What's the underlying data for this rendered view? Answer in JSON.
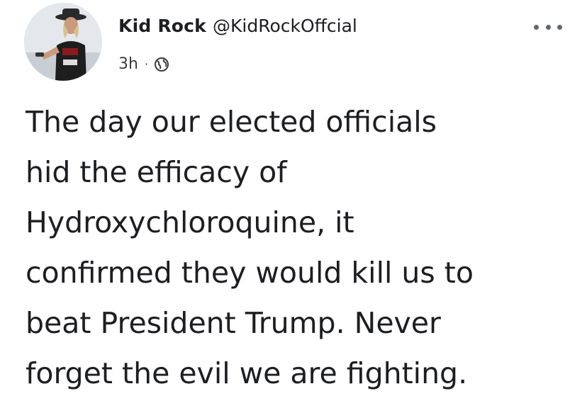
{
  "post": {
    "author_name": "Kid Rock",
    "author_handle": "@KidRockOffcial",
    "timestamp": "3h",
    "separator": "·",
    "audience_icon": "globe-icon",
    "more_icon": "more-options-icon",
    "text_lines": [
      "The day our elected officials",
      "hid the efficacy of",
      "Hydroxychloroquine, it",
      "confirmed they would kill us to",
      "beat President Trump. Never",
      "forget the evil we are fighting."
    ]
  },
  "colors": {
    "text": "#1c1e21",
    "meta_text": "#3a3b3c",
    "icon_gray": "#606770",
    "background": "#ffffff"
  }
}
